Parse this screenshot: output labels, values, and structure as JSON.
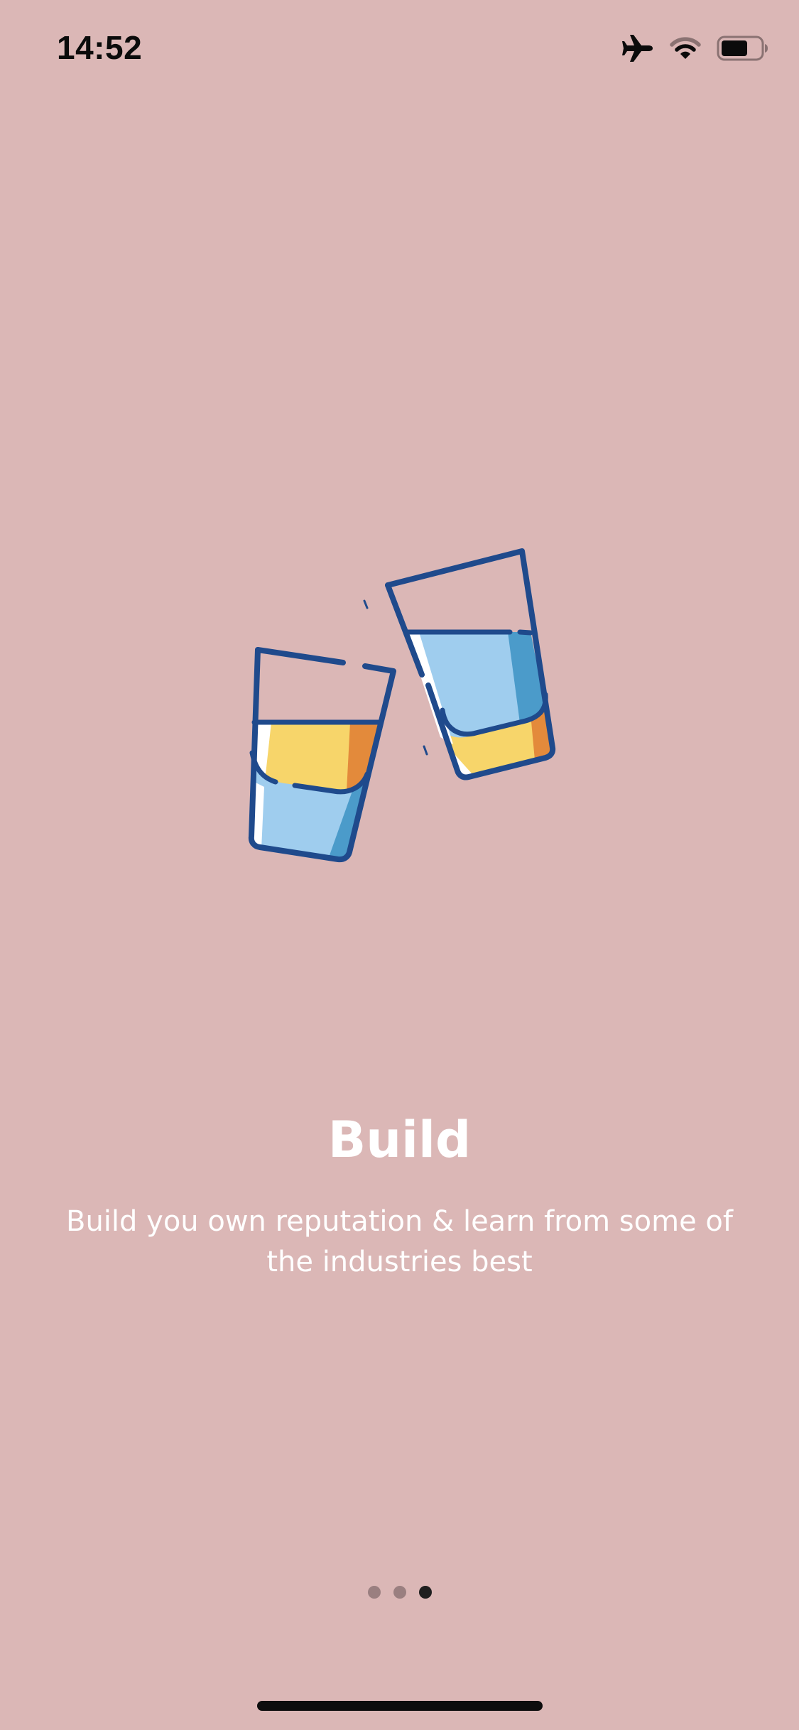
{
  "status_bar": {
    "time": "14:52",
    "icons": [
      "airplane-icon",
      "wifi-icon",
      "battery-icon"
    ]
  },
  "onboarding": {
    "illustration": "two-glasses-toasting-illustration",
    "title": "Build",
    "description": "Build you own reputation & learn from some of the industries best",
    "page_count": 3,
    "active_page": 3
  },
  "colors": {
    "background": "#dbb7b6",
    "text": "#ffffff",
    "outline": "#1f4a8c",
    "liquid_blue": "#9fcdee",
    "liquid_blue_dark": "#4b9bca",
    "liquid_yellow": "#f7d56a",
    "liquid_orange": "#e38a3b",
    "dot_inactive": "#9a7f80",
    "dot_active": "#1f1f1f"
  }
}
